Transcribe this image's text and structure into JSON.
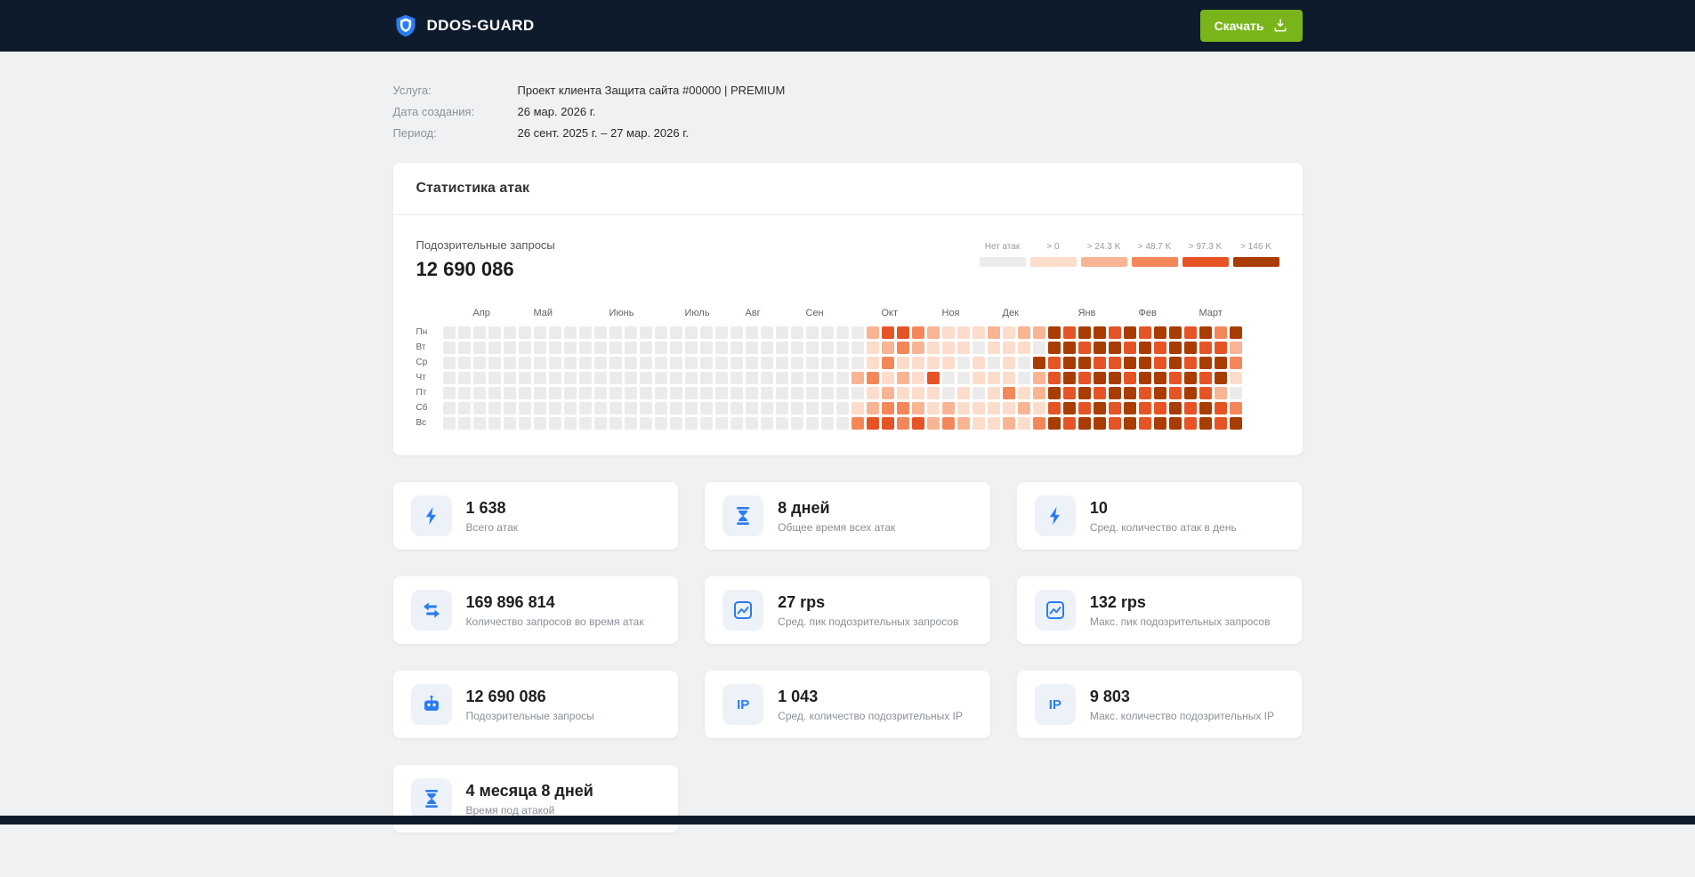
{
  "colors": {
    "header_bg": "#0e1b2c",
    "accent_blue": "#2b7cf0",
    "button_green": "#79b51a"
  },
  "header": {
    "brand": "DDOS-GUARD",
    "download_label": "Скачать"
  },
  "meta": {
    "rows": [
      {
        "label": "Услуга:",
        "value": "Проект клиента Защита сайта #00000 | PREMIUM"
      },
      {
        "label": "Дата создания:",
        "value": "26 мар. 2026 г."
      },
      {
        "label": "Период:",
        "value": "26 сент. 2025 г. – 27 мар. 2026 г."
      }
    ]
  },
  "attack_stats_card": {
    "title": "Статистика атак",
    "subtitle": "Подозрительные запросы",
    "total": "12 690 086"
  },
  "chart_data": {
    "type": "heatmap",
    "title": "Подозрительные запросы",
    "total_suspicious_requests": 12690086,
    "legend": [
      {
        "label": "Нет атак",
        "color": "#ebebeb"
      },
      {
        "label": "> 0",
        "color": "#fcdccb"
      },
      {
        "label": "> 24.3 K",
        "color": "#f9b493"
      },
      {
        "label": "> 48.7 K",
        "color": "#f4875a"
      },
      {
        "label": "> 97.3 K",
        "color": "#e65426"
      },
      {
        "label": "> 146 K",
        "color": "#a93c00"
      }
    ],
    "months": [
      {
        "label": "Апр",
        "week": 2
      },
      {
        "label": "Май",
        "week": 6
      },
      {
        "label": "Июнь",
        "week": 11
      },
      {
        "label": "Июль",
        "week": 16
      },
      {
        "label": "Авг",
        "week": 20
      },
      {
        "label": "Сен",
        "week": 24
      },
      {
        "label": "Окт",
        "week": 29
      },
      {
        "label": "Ноя",
        "week": 33
      },
      {
        "label": "Дек",
        "week": 37
      },
      {
        "label": "Янв",
        "week": 42
      },
      {
        "label": "Фев",
        "week": 46
      },
      {
        "label": "Март",
        "week": 50
      }
    ],
    "day_labels": [
      "Пн",
      "Вт",
      "Ср",
      "Чт",
      "Пт",
      "Сб",
      "Вс"
    ],
    "weeks": 53,
    "grid_levels_by_day": [
      "00000000000000000000000000002443211121225455454554535",
      "00000000000000000000000000001232111011105545545455442",
      "00000000000000000000000000001311110101054554455454553",
      "00000000000000000000000000023121400111024545545545451",
      "00000000000000000000000000001211101013125454554545420",
      "00000000000000000000000000012332121111214545454454543",
      "00000000000000000000000000034434232112135455454554545"
    ]
  },
  "stats": {
    "cards": [
      {
        "icon": "lightning-icon",
        "value": "1 638",
        "label": "Всего атак"
      },
      {
        "icon": "hourglass-icon",
        "value": "8 дней",
        "label": "Общее время всех атак"
      },
      {
        "icon": "lightning-icon",
        "value": "10",
        "label": "Сред. количество атак в день"
      },
      {
        "icon": "arrows-icon",
        "value": "169 896 814",
        "label": "Количество запросов во время атак"
      },
      {
        "icon": "chart-line-icon",
        "value": "27 rps",
        "label": "Сред. пик подозрительных запросов"
      },
      {
        "icon": "chart-line-icon",
        "value": "132 rps",
        "label": "Макс. пик подозрительных запросов"
      },
      {
        "icon": "bot-icon",
        "value": "12 690 086",
        "label": "Подозрительные запросы"
      },
      {
        "icon": "ip-icon",
        "value": "1 043",
        "label": "Сред. количество подозрительных IP"
      },
      {
        "icon": "ip-icon",
        "value": "9 803",
        "label": "Макс. количество подозрительных IP"
      },
      {
        "icon": "hourglass-icon",
        "value": "4 месяца 8 дней",
        "label": "Время под атакой"
      }
    ]
  }
}
